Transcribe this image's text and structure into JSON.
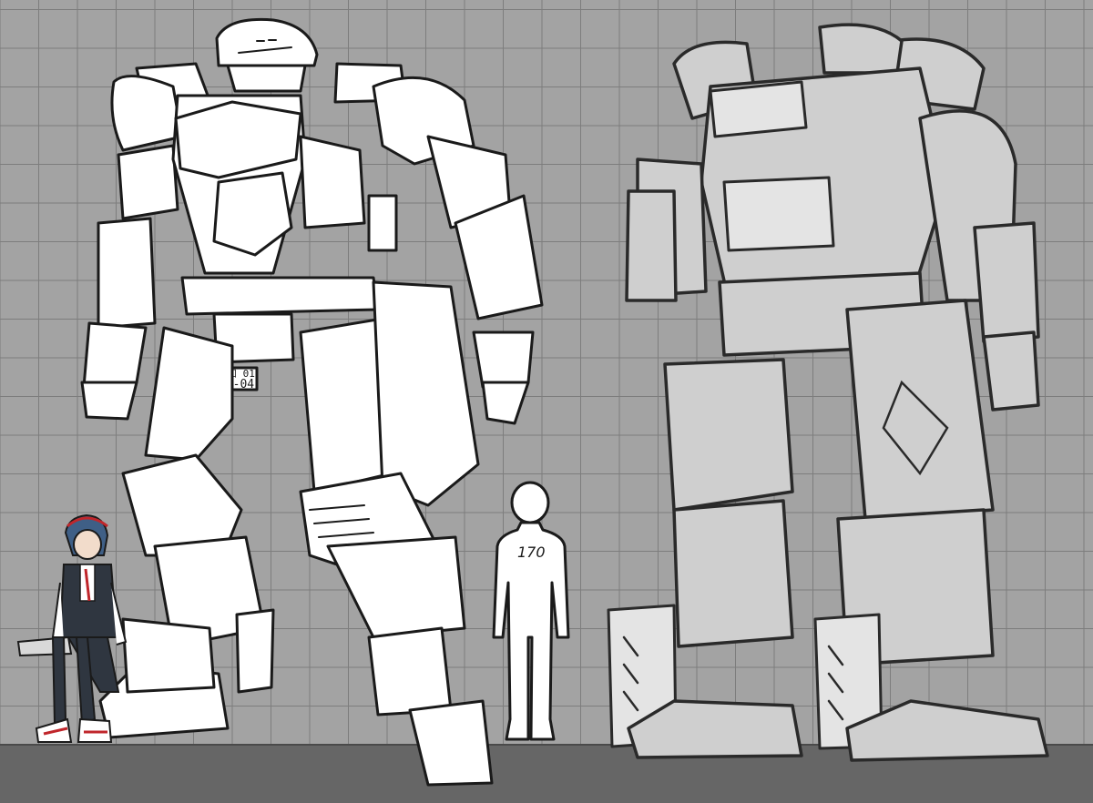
{
  "colors": {
    "background": "#a3a3a3",
    "grid_line": "#7d7d7d",
    "floor": "#666666",
    "line_art": "#1a1a1a",
    "mech_sketch_fill": "#cfcfcf",
    "pilot_hair": "#3f5f86",
    "pilot_jacket": "#2f3640",
    "accent_red": "#c0262b"
  },
  "mech": {
    "plate_top": "令和 01",
    "plate_bottom": "15-04"
  },
  "human": {
    "height_label": "170"
  },
  "icons": [
    "grid-background",
    "floor-strip",
    "mech-line-art",
    "pilot-character",
    "human-silhouette",
    "mech-sketch"
  ]
}
